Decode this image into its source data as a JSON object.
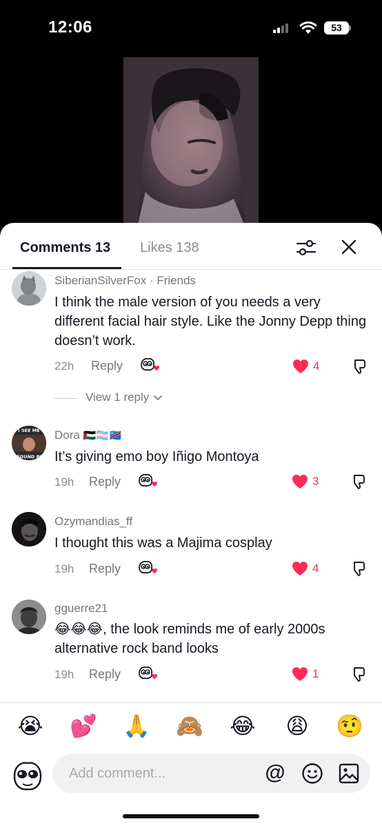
{
  "status_bar": {
    "time": "12:06",
    "battery": "53"
  },
  "tabs": {
    "comments": "Comments 13",
    "likes": "Likes 138"
  },
  "comments": [
    {
      "username": "SiberianSilverFox",
      "tag": "· Friends",
      "text": "I think the male version of you needs a very different facial hair style. Like the Jonny Depp thing doesn’t work.",
      "time": "22h",
      "reply": "Reply",
      "likes": "4",
      "view_replies": "View 1 reply"
    },
    {
      "username": "Dora",
      "flags": "🇵🇸🏳️‍⚧️🇨🇩",
      "text": "It’s giving emo boy Iñigo Montoya",
      "time": "19h",
      "reply": "Reply",
      "likes": "3",
      "avatar_caption_top": "I SEE ME",
      "avatar_caption_bottom": "FOUND PI"
    },
    {
      "username": "Ozymandias_ff",
      "text": "I thought this was a Majima cosplay",
      "time": "19h",
      "reply": "Reply",
      "likes": "4"
    },
    {
      "username": "gguerre21",
      "text": "😂😂😂, the look reminds me of early 2000s alternative rock band looks",
      "time": "19h",
      "reply": "Reply",
      "likes": "1"
    }
  ],
  "quick_emojis": [
    "😭",
    "💕",
    "🙏",
    "🙈",
    "😂",
    "😩",
    "🤨"
  ],
  "composer": {
    "placeholder": "Add comment...",
    "at_symbol": "@"
  },
  "colors": {
    "accent": "#fe2c55",
    "text": "#161823",
    "muted": "#8a8b91"
  },
  "icons": [
    "signal-icon",
    "wifi-icon",
    "battery-icon",
    "filter-icon",
    "close-icon",
    "reaction-icon",
    "heart-icon",
    "thumbs-down-icon",
    "chevron-down-icon",
    "smiley-icon",
    "image-icon"
  ]
}
